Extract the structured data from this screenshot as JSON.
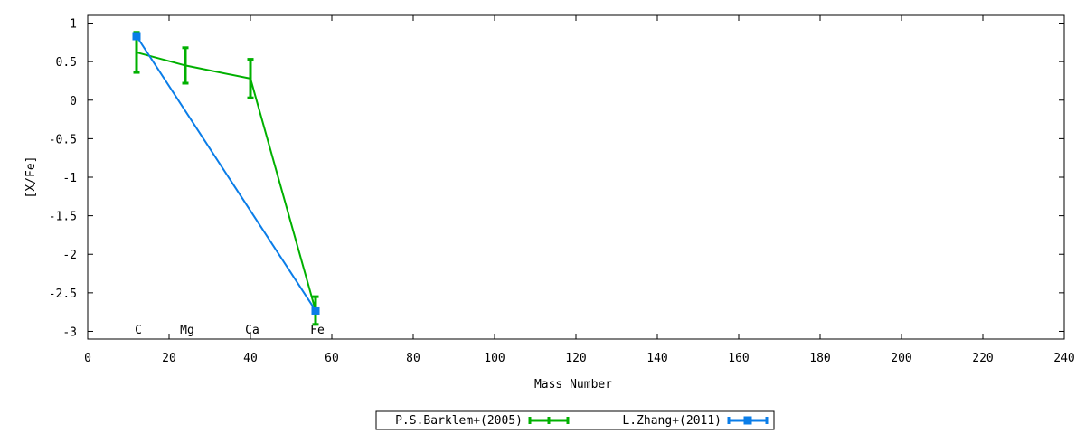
{
  "chart_data": {
    "type": "line",
    "xlabel": "Mass Number",
    "ylabel": "[X/Fe]",
    "xlim": [
      0,
      240
    ],
    "ylim": [
      -3.1,
      1.1
    ],
    "x_ticks": [
      0,
      20,
      40,
      60,
      80,
      100,
      120,
      140,
      160,
      180,
      200,
      220,
      240
    ],
    "y_ticks": [
      1,
      0.5,
      0,
      -0.5,
      -1,
      -1.5,
      -2,
      -2.5,
      -3
    ],
    "y_tick_labels": [
      "1",
      "0.5",
      "0",
      "-0.5",
      "-1",
      "-1.5",
      "-2",
      "-2.5",
      "-3"
    ],
    "grid": false,
    "legend_position": "bottom-center",
    "element_labels": [
      {
        "text": "C",
        "x": 12
      },
      {
        "text": "Mg",
        "x": 24
      },
      {
        "text": "Ca",
        "x": 40
      },
      {
        "text": "Fe",
        "x": 56
      }
    ],
    "series": [
      {
        "name": "P.S.Barklem+(2005)",
        "color": "#00b000",
        "marker": "errorbar",
        "points": [
          {
            "x": 12,
            "y": 0.62,
            "err": 0.26
          },
          {
            "x": 24,
            "y": 0.45,
            "err": 0.23
          },
          {
            "x": 40,
            "y": 0.28,
            "err": 0.25
          },
          {
            "x": 56,
            "y": -2.73,
            "err": 0.18
          }
        ]
      },
      {
        "name": "L.Zhang+(2011)",
        "color": "#0a7de8",
        "marker": "square",
        "points": [
          {
            "x": 12,
            "y": 0.83,
            "err": 0.03
          },
          {
            "x": 56,
            "y": -2.73,
            "err": 0.03
          }
        ]
      }
    ]
  }
}
